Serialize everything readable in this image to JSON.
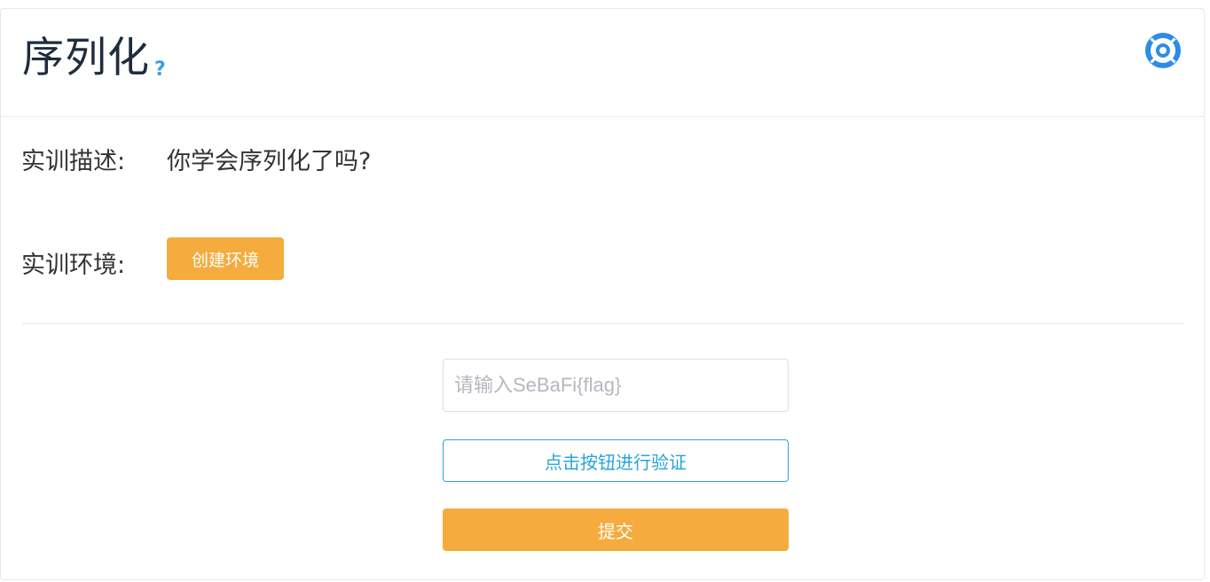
{
  "header": {
    "title": "序列化",
    "help_mark": "?",
    "settings_icon": "lifebuoy-settings-icon"
  },
  "description": {
    "label": "实训描述:",
    "value": "你学会序列化了吗?"
  },
  "environment": {
    "label": "实训环境:",
    "create_button": "创建环境"
  },
  "flag_form": {
    "input_value": "",
    "input_placeholder": "请输入SeBaFi{flag}",
    "verify_button": "点击按钮进行验证",
    "submit_button": "提交"
  },
  "colors": {
    "accent_orange": "#f5ab3d",
    "accent_blue": "#2aa3d8",
    "icon_blue": "#2d8ce8"
  }
}
